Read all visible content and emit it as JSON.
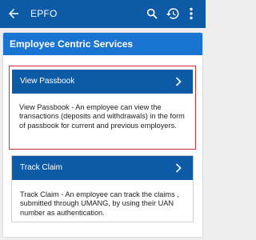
{
  "appbar": {
    "title": "EPFO",
    "background": "#0d5aa7",
    "icons": [
      "back-arrow-icon",
      "search-icon",
      "history-icon",
      "more-vert-icon"
    ]
  },
  "panel": {
    "title": "Employee Centric Services",
    "header_color": "#1a75d2"
  },
  "cards": [
    {
      "label": "View Passbook",
      "description": "View Passbook - An employee can view the transactions (deposits and withdrawals) in the form of passbook for current and previous employers.",
      "highlighted": true,
      "highlight_color": "#d32f2f"
    },
    {
      "label": "Track Claim",
      "description": "Track Claim - An employee can track the claims , submitted through UMANG, by using their UAN number as authentication.",
      "highlighted": false
    }
  ]
}
